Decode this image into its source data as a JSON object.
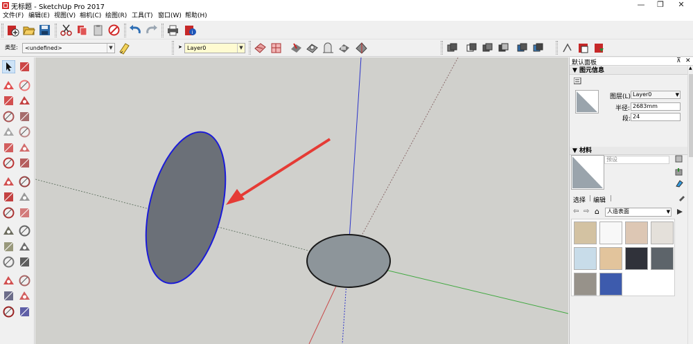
{
  "window": {
    "title": "无标题 - SketchUp Pro 2017",
    "controls": [
      "—",
      "❐",
      "✕"
    ]
  },
  "menu": [
    "文件(F)",
    "编辑(E)",
    "视图(V)",
    "相机(C)",
    "绘图(R)",
    "工具(T)",
    "窗口(W)",
    "帮助(H)"
  ],
  "toolbar2": {
    "type_label": "类型:",
    "type_value": "<undefined>",
    "layer_value": "Layer0"
  },
  "tray": {
    "title": "默认面板",
    "pin": "⊼",
    "close": "✕"
  },
  "entity_info": {
    "header": "▼ 图元信息",
    "layer_label": "图层(L):",
    "layer_value": "Layer0",
    "radius_label": "半径:",
    "radius_value": "2683mm",
    "segments_label": "段:",
    "segments_value": "24"
  },
  "materials": {
    "header": "▼ 材料",
    "name_placeholder": "预设",
    "tab_select": "选择",
    "tab_edit": "编辑",
    "library": "人造表面",
    "swatch_colors": [
      "#d3c2a2",
      "#f8f8f8",
      "#ddc7b4",
      "#e4e0da",
      "#c8dce9",
      "#e2c49c",
      "#30323a",
      "#5d646a",
      "#97928a",
      "#3d5bad"
    ]
  },
  "colors": {
    "viewport_bg": "#d0d0cc",
    "axis_blue": "#2b33c9",
    "axis_red": "#c84848",
    "axis_green": "#3fa83f",
    "face_dark": "#6b7078",
    "face_light": "#8d959a",
    "selection_blue": "#1b1bd8",
    "arrow_red": "#e53b35"
  },
  "icons": {
    "toolbar1": [
      "new-file-icon",
      "open-folder-icon",
      "save-icon",
      "cut-icon",
      "copy-icon",
      "paste-icon",
      "erase-icon",
      "undo-icon",
      "redo-icon",
      "print-icon",
      "model-info-icon"
    ],
    "toolbar2_left": [
      "paint-icon"
    ],
    "toolbar2_mid": [
      "orbit-icon",
      "pan-icon",
      "zoom-icon",
      "zoom-window-icon",
      "zoom-extents-icon",
      "camera-icon",
      "walk-icon"
    ],
    "toolbar2_right": [
      "iso-view-icon",
      "top-view-icon",
      "front-view-icon",
      "right-view-icon",
      "back-view-icon",
      "left-view-icon"
    ],
    "toolbar2_end": [
      "3d-warehouse-icon",
      "extension-warehouse-icon",
      "share-model-icon"
    ],
    "left_tools": [
      "select-icon",
      "make-component-icon",
      "paint-bucket-icon",
      "eraser-icon",
      "line-icon",
      "freehand-icon",
      "rectangle-icon",
      "rotated-rectangle-icon",
      "circle-icon",
      "polygon-icon",
      "arc-icon",
      "two-point-arc-icon",
      "three-point-arc-icon",
      "pie-icon",
      "move-icon",
      "push-pull-icon",
      "rotate-icon",
      "follow-me-icon",
      "scale-icon",
      "offset-icon",
      "tape-measure-icon",
      "dimension-icon",
      "protractor-icon",
      "text-icon",
      "axes-icon",
      "3d-text-icon",
      "orbit-icon",
      "pan-icon",
      "zoom-icon",
      "zoom-window-icon",
      "zoom-extents-icon",
      "previous-view-icon"
    ]
  }
}
